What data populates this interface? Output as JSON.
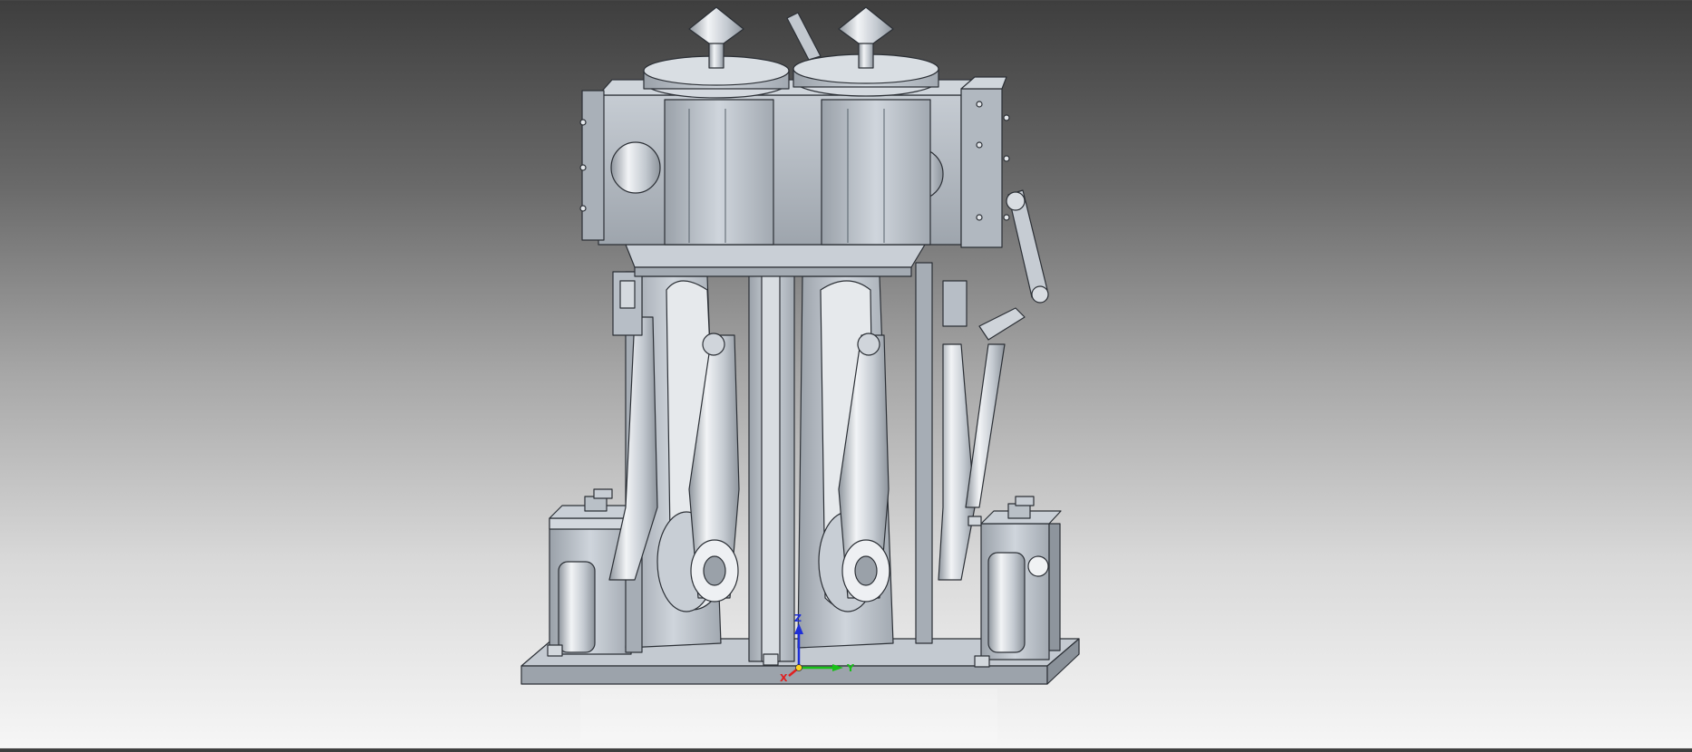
{
  "viewport": {
    "background_top": "#3e3e3e",
    "background_bottom": "#f6f6f6",
    "model": "twin-cylinder-steam-engine",
    "model_color": "#b9c0c8"
  },
  "triad": {
    "z_label": "Z",
    "y_label": "Y",
    "x_label": "X",
    "colors": {
      "x": "#e02020",
      "y": "#18c018",
      "z": "#1e2fd8"
    }
  }
}
